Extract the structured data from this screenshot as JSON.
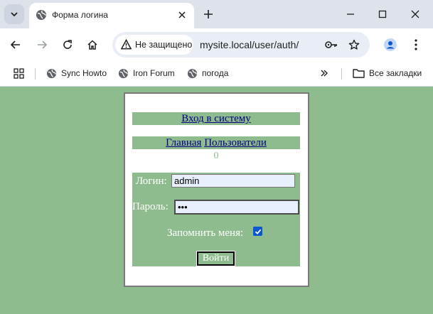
{
  "browser": {
    "tab_title": "Форма логина",
    "security_label": "Не защищено",
    "url": "mysite.local/user/auth/",
    "bookmarks": [
      "Sync Howto",
      "Iron Forum",
      "погода"
    ],
    "all_bookmarks_label": "Все закладки"
  },
  "page": {
    "title_link": "Вход в систему",
    "nav_links": [
      "Главная",
      "Пользователи"
    ],
    "counter": "0",
    "form": {
      "login_label": "Логин:",
      "login_value": "admin",
      "password_label": "Пароль:",
      "password_value": "•••",
      "remember_label": "Запомнить меня:",
      "remember_checked": true,
      "submit_label": "Войти"
    }
  },
  "colors": {
    "page_background": "#8fbc8f",
    "link": "#000080",
    "checkbox_accent": "#0b57d0"
  }
}
